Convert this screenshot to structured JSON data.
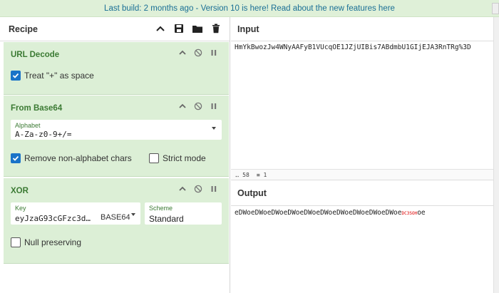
{
  "banner": {
    "link1": "Last build: 2 months ago",
    "sep": " - Version 10 is here! Read about the new features ",
    "link2": "here"
  },
  "recipe": {
    "title": "Recipe",
    "ops": [
      {
        "title": "URL Decode",
        "checkbox": {
          "label": "Treat \"+\" as space",
          "checked": true
        }
      },
      {
        "title": "From Base64",
        "alphabet": {
          "label": "Alphabet",
          "value": "A-Za-z0-9+/="
        },
        "remove_nonalpha": {
          "label": "Remove non-alphabet chars",
          "checked": true
        },
        "strict": {
          "label": "Strict mode",
          "checked": false
        }
      },
      {
        "title": "XOR",
        "key": {
          "label": "Key",
          "value": "eyJzaG93cGFzc3d…",
          "encoding": "BASE64"
        },
        "scheme": {
          "label": "Scheme",
          "value": "Standard"
        },
        "null_preserving": {
          "label": "Null preserving",
          "checked": false
        }
      }
    ]
  },
  "input": {
    "title": "Input",
    "text": "HmYkBwozJw4WNyAAFyB1VUcqOE1JZjUIBis7ABdmbU1GIjEJA3RnTRg%3D",
    "stats": {
      "length": "58",
      "lines": "1"
    }
  },
  "output": {
    "title": "Output",
    "text": "eDWoeDWoeDWoeDWoeDWoeDWoeDWoeDWoeDWoeDWoe",
    "control": "DC3SOH",
    "tail": "oe"
  },
  "colors": {
    "accent_green": "#3b7a33",
    "op_bg": "#dcefd6",
    "banner_bg": "#dff0d8",
    "link_blue": "#1a6f95",
    "check_blue": "#1a73c8"
  }
}
